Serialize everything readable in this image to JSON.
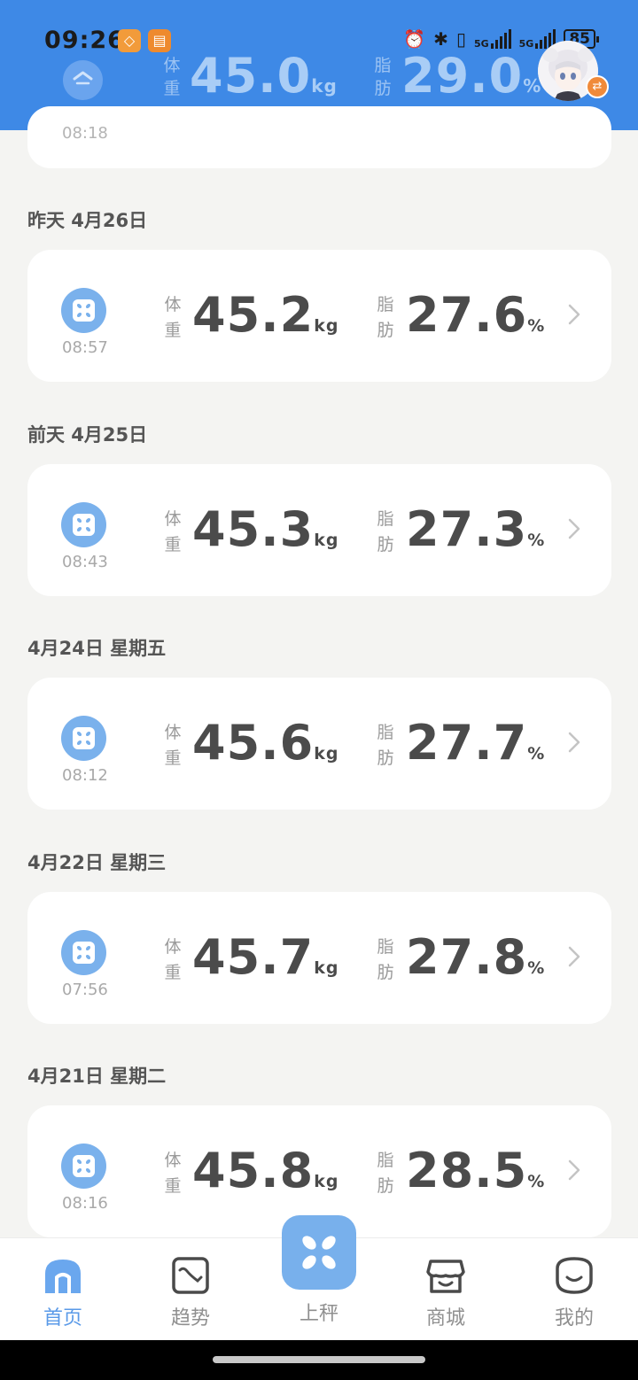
{
  "status_bar": {
    "time": "09:26",
    "battery": "85",
    "network_a": "5G",
    "network_b": "5G"
  },
  "header": {
    "weight_label_1": "体",
    "weight_label_2": "重",
    "weight_value": "45.0",
    "weight_unit": "kg",
    "fat_label_1": "脂",
    "fat_label_2": "肪",
    "fat_value": "29.0",
    "fat_unit": "%"
  },
  "partial_record": {
    "time": "08:18"
  },
  "records": [
    {
      "date": "昨天 4月26日",
      "time": "08:57",
      "weight": "45.2",
      "fat": "27.6"
    },
    {
      "date": "前天 4月25日",
      "time": "08:43",
      "weight": "45.3",
      "fat": "27.3"
    },
    {
      "date": "4月24日  星期五",
      "time": "08:12",
      "weight": "45.6",
      "fat": "27.7"
    },
    {
      "date": "4月22日  星期三",
      "time": "07:56",
      "weight": "45.7",
      "fat": "27.8"
    },
    {
      "date": "4月21日  星期二",
      "time": "08:16",
      "weight": "45.8",
      "fat": "28.5"
    }
  ],
  "labels": {
    "weight_1": "体",
    "weight_2": "重",
    "weight_unit": "kg",
    "fat_1": "脂",
    "fat_2": "肪",
    "fat_unit": "%"
  },
  "nav": {
    "home": "首页",
    "trend": "趋势",
    "weigh": "上秤",
    "store": "商城",
    "me": "我的"
  },
  "colors": {
    "header_bg": "#3e89e6",
    "accent": "#78b0ec",
    "active_nav": "#5a9ae8"
  }
}
